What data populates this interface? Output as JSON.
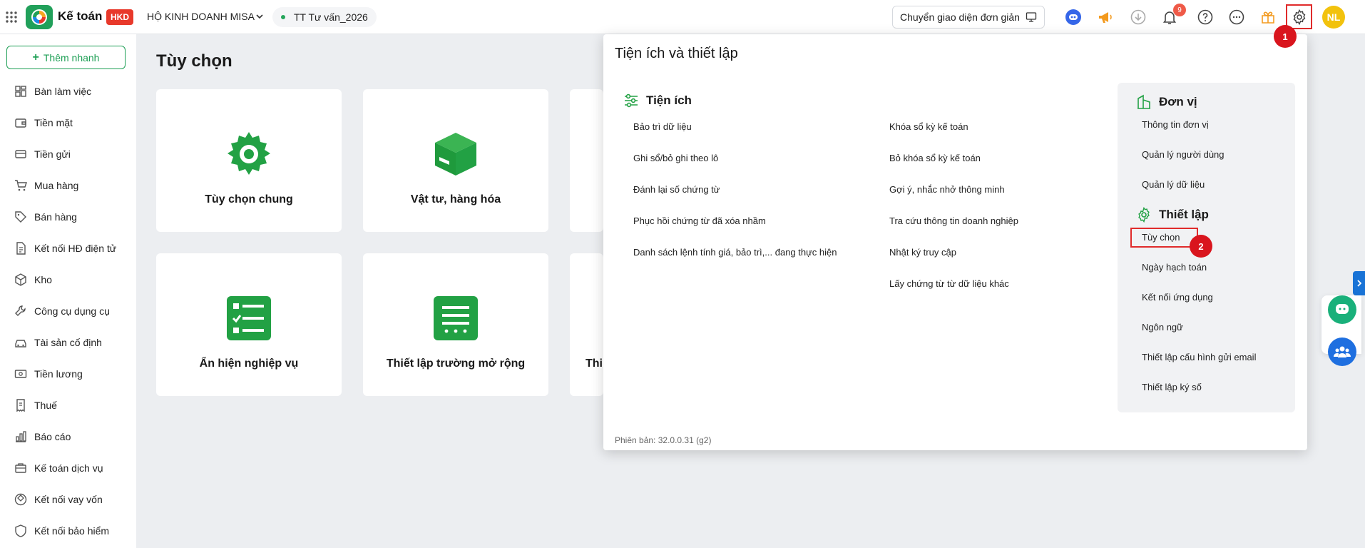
{
  "header": {
    "app_name": "Kế toán",
    "badge": "HKD",
    "company": "HỘ KINH DOANH MISA",
    "database": "TT Tư vấn_2026",
    "switch_label": "Chuyển giao diện đơn giản",
    "notification_count": "9",
    "avatar_initials": "NL"
  },
  "sidebar": {
    "add_label": "Thêm nhanh",
    "items": [
      {
        "label": "Bàn làm việc",
        "icon": "dashboard-icon"
      },
      {
        "label": "Tiền mặt",
        "icon": "wallet-icon"
      },
      {
        "label": "Tiền gửi",
        "icon": "card-icon"
      },
      {
        "label": "Mua hàng",
        "icon": "cart-icon"
      },
      {
        "label": "Bán hàng",
        "icon": "tag-icon"
      },
      {
        "label": "Kết nối HĐ điện tử",
        "icon": "invoice-icon"
      },
      {
        "label": "Kho",
        "icon": "box-icon"
      },
      {
        "label": "Công cụ dụng cụ",
        "icon": "wrench-icon"
      },
      {
        "label": "Tài sản cố định",
        "icon": "car-icon"
      },
      {
        "label": "Tiền lương",
        "icon": "money-icon"
      },
      {
        "label": "Thuế",
        "icon": "receipt-icon"
      },
      {
        "label": "Báo cáo",
        "icon": "chart-icon"
      },
      {
        "label": "Kế toán dịch vụ",
        "icon": "briefcase-icon"
      },
      {
        "label": "Kết nối vay vốn",
        "icon": "loan-icon"
      },
      {
        "label": "Kết nối bảo hiểm",
        "icon": "shield-icon"
      }
    ]
  },
  "main": {
    "title": "Tùy chọn",
    "cards": [
      {
        "label": "Tùy chọn chung"
      },
      {
        "label": "Vật tư, hàng hóa"
      },
      {
        "label": "Ẩn hiện nghiệp vụ"
      },
      {
        "label": "Thiết lập trường mở rộng"
      },
      {
        "label": "Thi"
      }
    ]
  },
  "panel": {
    "title": "Tiện ích và thiết lập",
    "utilities": {
      "heading": "Tiện ích",
      "col1": [
        "Bảo trì dữ liệu",
        "Ghi sổ/bỏ ghi theo lô",
        "Đánh lại số chứng từ",
        "Phục hồi chứng từ đã xóa nhầm",
        "Danh sách lệnh tính giá, bảo trì,... đang thực hiện"
      ],
      "col2": [
        "Khóa sổ kỳ kế toán",
        "Bỏ khóa sổ kỳ kế toán",
        "Gợi ý, nhắc nhở thông minh",
        "Tra cứu thông tin doanh nghiệp",
        "Nhật ký truy cập",
        "Lấy chứng từ từ dữ liệu khác"
      ]
    },
    "unit": {
      "heading": "Đơn vị",
      "items": [
        "Thông tin đơn vị",
        "Quản lý người dùng",
        "Quản lý dữ liệu"
      ]
    },
    "setup": {
      "heading": "Thiết lập",
      "items": [
        "Tùy chọn",
        "Ngày hạch toán",
        "Kết nối ứng dụng",
        "Ngôn ngữ",
        "Thiết lập cấu hình gửi email",
        "Thiết lập ký số"
      ]
    },
    "version": "Phiên bản: 32.0.0.31 (g2)"
  },
  "steps": [
    "1",
    "2"
  ],
  "colors": {
    "brand_green": "#1e9f55",
    "highlight_red": "#e02b2b",
    "step_red": "#d9151d"
  }
}
